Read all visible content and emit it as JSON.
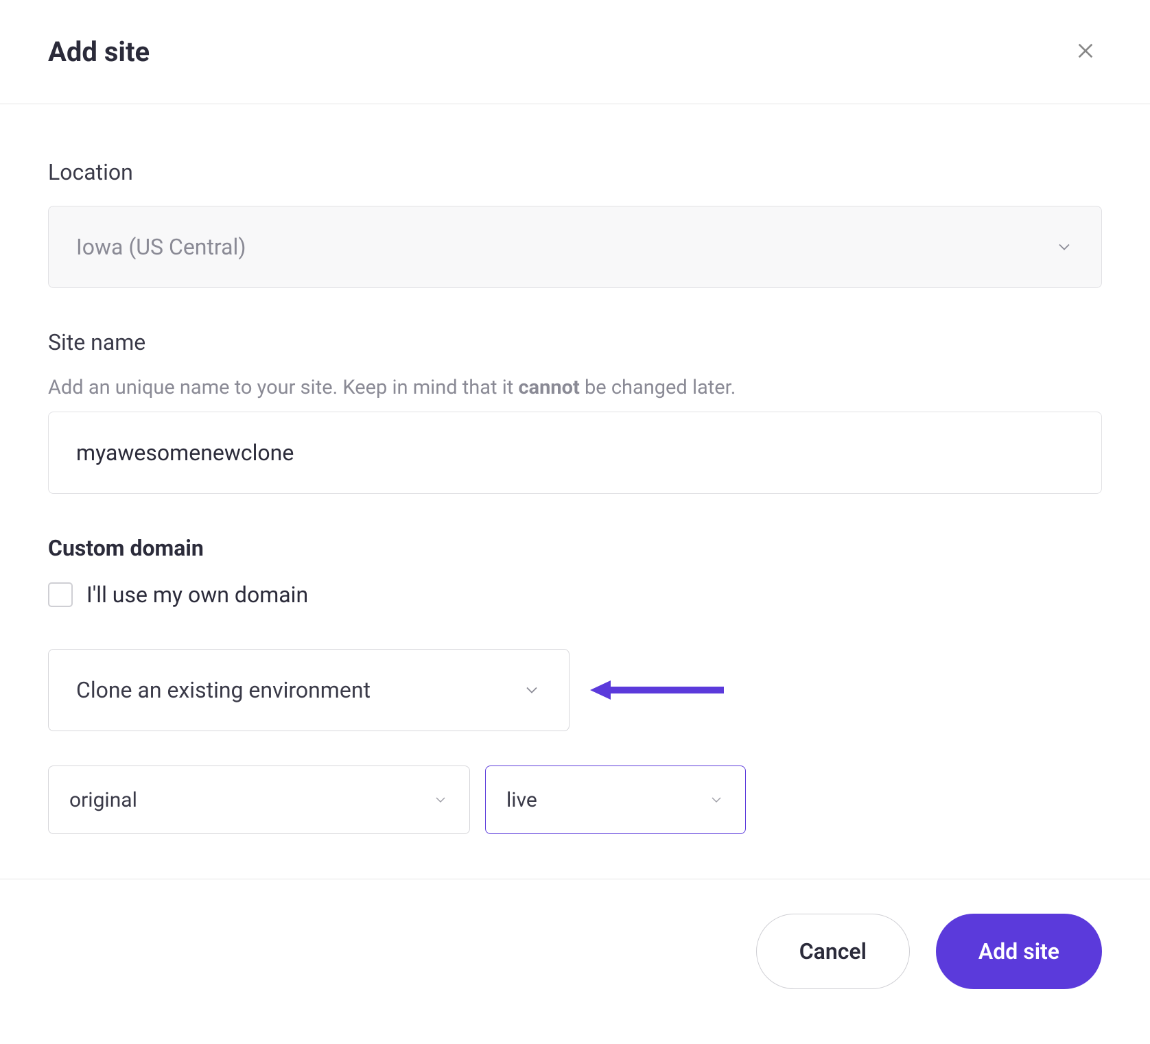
{
  "header": {
    "title": "Add site"
  },
  "location": {
    "label": "Location",
    "value": "Iowa (US Central)"
  },
  "siteName": {
    "label": "Site name",
    "helperPrefix": "Add an unique name to your site. Keep in mind that it ",
    "helperBold": "cannot",
    "helperSuffix": " be changed later.",
    "value": "myawesomenewclone"
  },
  "customDomain": {
    "label": "Custom domain",
    "checkboxLabel": "I'll use my own domain"
  },
  "cloneSelect": {
    "value": "Clone an existing environment"
  },
  "originalSelect": {
    "value": "original"
  },
  "liveSelect": {
    "value": "live"
  },
  "footer": {
    "cancelLabel": "Cancel",
    "addSiteLabel": "Add site"
  }
}
